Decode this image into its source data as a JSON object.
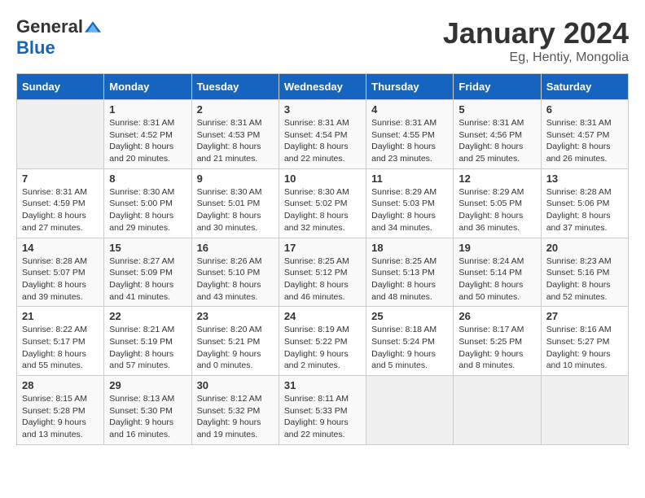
{
  "header": {
    "logo_general": "General",
    "logo_blue": "Blue",
    "month_title": "January 2024",
    "location": "Eg, Hentiy, Mongolia"
  },
  "weekdays": [
    "Sunday",
    "Monday",
    "Tuesday",
    "Wednesday",
    "Thursday",
    "Friday",
    "Saturday"
  ],
  "weeks": [
    [
      {
        "day": "",
        "sunrise": "",
        "sunset": "",
        "daylight": ""
      },
      {
        "day": "1",
        "sunrise": "Sunrise: 8:31 AM",
        "sunset": "Sunset: 4:52 PM",
        "daylight": "Daylight: 8 hours and 20 minutes."
      },
      {
        "day": "2",
        "sunrise": "Sunrise: 8:31 AM",
        "sunset": "Sunset: 4:53 PM",
        "daylight": "Daylight: 8 hours and 21 minutes."
      },
      {
        "day": "3",
        "sunrise": "Sunrise: 8:31 AM",
        "sunset": "Sunset: 4:54 PM",
        "daylight": "Daylight: 8 hours and 22 minutes."
      },
      {
        "day": "4",
        "sunrise": "Sunrise: 8:31 AM",
        "sunset": "Sunset: 4:55 PM",
        "daylight": "Daylight: 8 hours and 23 minutes."
      },
      {
        "day": "5",
        "sunrise": "Sunrise: 8:31 AM",
        "sunset": "Sunset: 4:56 PM",
        "daylight": "Daylight: 8 hours and 25 minutes."
      },
      {
        "day": "6",
        "sunrise": "Sunrise: 8:31 AM",
        "sunset": "Sunset: 4:57 PM",
        "daylight": "Daylight: 8 hours and 26 minutes."
      }
    ],
    [
      {
        "day": "7",
        "sunrise": "Sunrise: 8:31 AM",
        "sunset": "Sunset: 4:59 PM",
        "daylight": "Daylight: 8 hours and 27 minutes."
      },
      {
        "day": "8",
        "sunrise": "Sunrise: 8:30 AM",
        "sunset": "Sunset: 5:00 PM",
        "daylight": "Daylight: 8 hours and 29 minutes."
      },
      {
        "day": "9",
        "sunrise": "Sunrise: 8:30 AM",
        "sunset": "Sunset: 5:01 PM",
        "daylight": "Daylight: 8 hours and 30 minutes."
      },
      {
        "day": "10",
        "sunrise": "Sunrise: 8:30 AM",
        "sunset": "Sunset: 5:02 PM",
        "daylight": "Daylight: 8 hours and 32 minutes."
      },
      {
        "day": "11",
        "sunrise": "Sunrise: 8:29 AM",
        "sunset": "Sunset: 5:03 PM",
        "daylight": "Daylight: 8 hours and 34 minutes."
      },
      {
        "day": "12",
        "sunrise": "Sunrise: 8:29 AM",
        "sunset": "Sunset: 5:05 PM",
        "daylight": "Daylight: 8 hours and 36 minutes."
      },
      {
        "day": "13",
        "sunrise": "Sunrise: 8:28 AM",
        "sunset": "Sunset: 5:06 PM",
        "daylight": "Daylight: 8 hours and 37 minutes."
      }
    ],
    [
      {
        "day": "14",
        "sunrise": "Sunrise: 8:28 AM",
        "sunset": "Sunset: 5:07 PM",
        "daylight": "Daylight: 8 hours and 39 minutes."
      },
      {
        "day": "15",
        "sunrise": "Sunrise: 8:27 AM",
        "sunset": "Sunset: 5:09 PM",
        "daylight": "Daylight: 8 hours and 41 minutes."
      },
      {
        "day": "16",
        "sunrise": "Sunrise: 8:26 AM",
        "sunset": "Sunset: 5:10 PM",
        "daylight": "Daylight: 8 hours and 43 minutes."
      },
      {
        "day": "17",
        "sunrise": "Sunrise: 8:25 AM",
        "sunset": "Sunset: 5:12 PM",
        "daylight": "Daylight: 8 hours and 46 minutes."
      },
      {
        "day": "18",
        "sunrise": "Sunrise: 8:25 AM",
        "sunset": "Sunset: 5:13 PM",
        "daylight": "Daylight: 8 hours and 48 minutes."
      },
      {
        "day": "19",
        "sunrise": "Sunrise: 8:24 AM",
        "sunset": "Sunset: 5:14 PM",
        "daylight": "Daylight: 8 hours and 50 minutes."
      },
      {
        "day": "20",
        "sunrise": "Sunrise: 8:23 AM",
        "sunset": "Sunset: 5:16 PM",
        "daylight": "Daylight: 8 hours and 52 minutes."
      }
    ],
    [
      {
        "day": "21",
        "sunrise": "Sunrise: 8:22 AM",
        "sunset": "Sunset: 5:17 PM",
        "daylight": "Daylight: 8 hours and 55 minutes."
      },
      {
        "day": "22",
        "sunrise": "Sunrise: 8:21 AM",
        "sunset": "Sunset: 5:19 PM",
        "daylight": "Daylight: 8 hours and 57 minutes."
      },
      {
        "day": "23",
        "sunrise": "Sunrise: 8:20 AM",
        "sunset": "Sunset: 5:21 PM",
        "daylight": "Daylight: 9 hours and 0 minutes."
      },
      {
        "day": "24",
        "sunrise": "Sunrise: 8:19 AM",
        "sunset": "Sunset: 5:22 PM",
        "daylight": "Daylight: 9 hours and 2 minutes."
      },
      {
        "day": "25",
        "sunrise": "Sunrise: 8:18 AM",
        "sunset": "Sunset: 5:24 PM",
        "daylight": "Daylight: 9 hours and 5 minutes."
      },
      {
        "day": "26",
        "sunrise": "Sunrise: 8:17 AM",
        "sunset": "Sunset: 5:25 PM",
        "daylight": "Daylight: 9 hours and 8 minutes."
      },
      {
        "day": "27",
        "sunrise": "Sunrise: 8:16 AM",
        "sunset": "Sunset: 5:27 PM",
        "daylight": "Daylight: 9 hours and 10 minutes."
      }
    ],
    [
      {
        "day": "28",
        "sunrise": "Sunrise: 8:15 AM",
        "sunset": "Sunset: 5:28 PM",
        "daylight": "Daylight: 9 hours and 13 minutes."
      },
      {
        "day": "29",
        "sunrise": "Sunrise: 8:13 AM",
        "sunset": "Sunset: 5:30 PM",
        "daylight": "Daylight: 9 hours and 16 minutes."
      },
      {
        "day": "30",
        "sunrise": "Sunrise: 8:12 AM",
        "sunset": "Sunset: 5:32 PM",
        "daylight": "Daylight: 9 hours and 19 minutes."
      },
      {
        "day": "31",
        "sunrise": "Sunrise: 8:11 AM",
        "sunset": "Sunset: 5:33 PM",
        "daylight": "Daylight: 9 hours and 22 minutes."
      },
      {
        "day": "",
        "sunrise": "",
        "sunset": "",
        "daylight": ""
      },
      {
        "day": "",
        "sunrise": "",
        "sunset": "",
        "daylight": ""
      },
      {
        "day": "",
        "sunrise": "",
        "sunset": "",
        "daylight": ""
      }
    ]
  ]
}
